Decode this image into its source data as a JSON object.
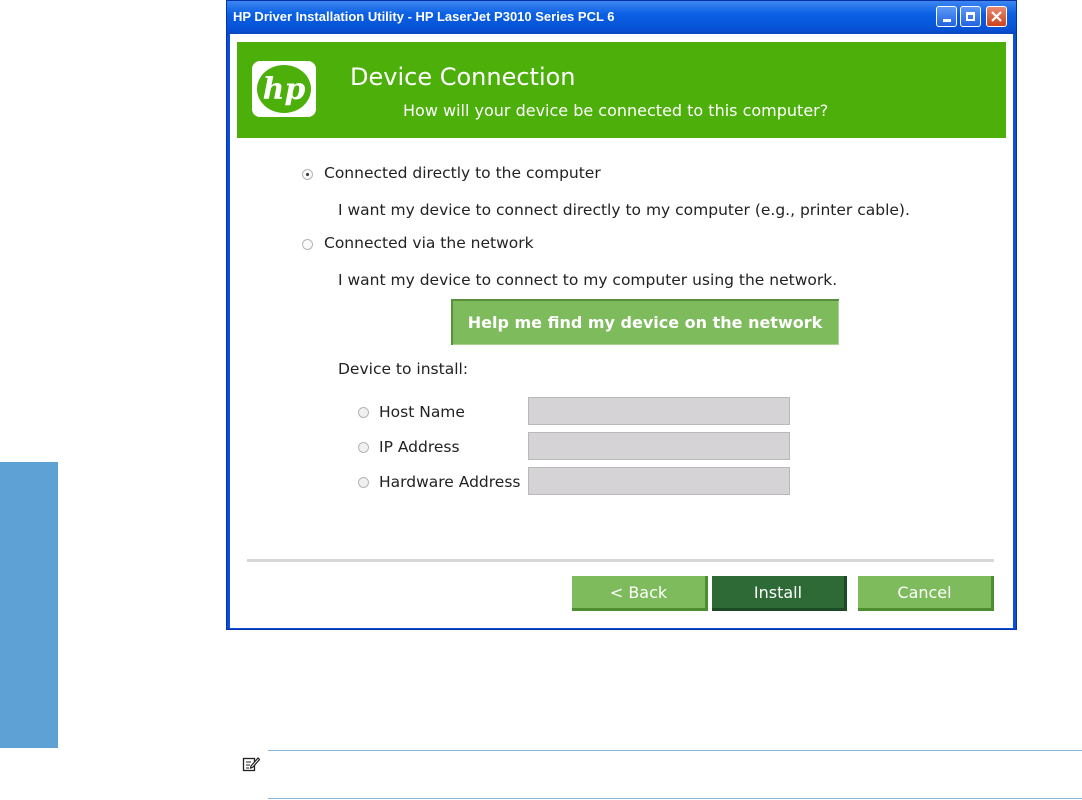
{
  "window": {
    "title": "HP Driver Installation Utility - HP LaserJet P3010 Series PCL 6"
  },
  "banner": {
    "logo_text": "hp",
    "title": "Device Connection",
    "subtitle": "How will your device be connected to this computer?"
  },
  "options": {
    "direct": {
      "label": "Connected directly to the computer",
      "description": "I want my device to connect directly to my computer (e.g., printer cable).",
      "selected": true
    },
    "network": {
      "label": "Connected via the network",
      "description": "I want my device to connect to my computer using the network.",
      "selected": false
    }
  },
  "help_button": "Help me find my device on the network",
  "device_section": {
    "heading": "Device to install:",
    "fields": [
      {
        "label": "Host Name",
        "value": ""
      },
      {
        "label": "IP Address",
        "value": ""
      },
      {
        "label": "Hardware Address",
        "value": ""
      }
    ]
  },
  "buttons": {
    "back": "< Back",
    "install": "Install",
    "cancel": "Cancel"
  },
  "colors": {
    "banner": "#4caf0a",
    "button_light": "#7dbb5c",
    "button_dark": "#2d6a36",
    "side_tab": "#5ea1d4"
  },
  "icons": [
    "minimize-icon",
    "maximize-icon",
    "close-icon",
    "hp-logo",
    "note-icon"
  ]
}
